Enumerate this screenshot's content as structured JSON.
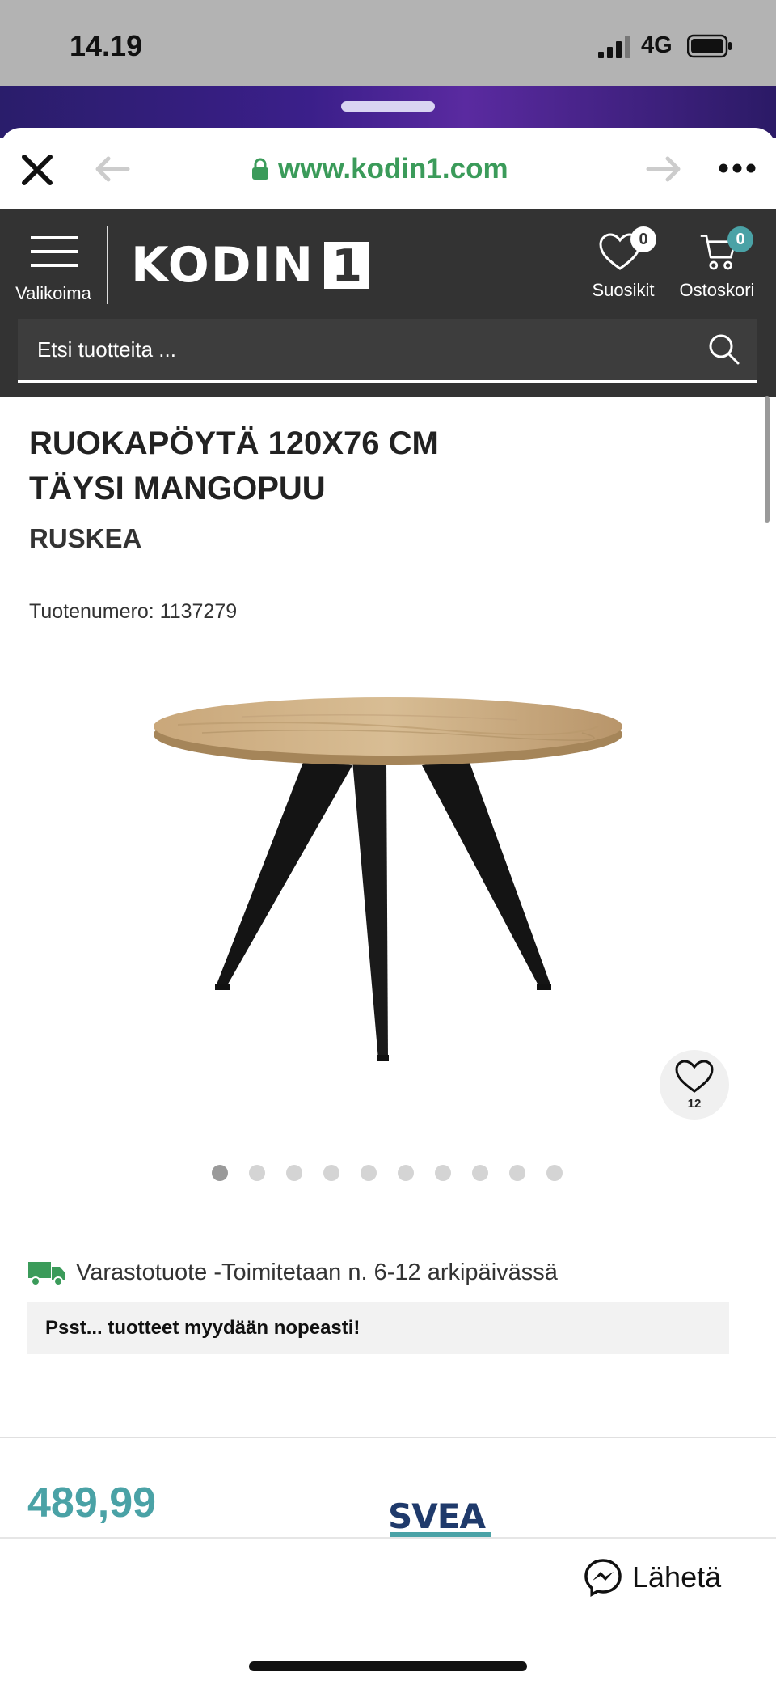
{
  "status_bar": {
    "time": "14.19",
    "network": "4G"
  },
  "browser": {
    "url": "www.kodin1.com"
  },
  "header": {
    "menu_label": "Valikoima",
    "logo_text": "KODIN",
    "logo_number": "1",
    "favorites_label": "Suosikit",
    "favorites_count": "0",
    "cart_label": "Ostoskori",
    "cart_count": "0",
    "search_placeholder": "Etsi tuotteita ..."
  },
  "product": {
    "title_line1": "RUOKAPÖYTÄ 120X76 CM",
    "title_line2": "TÄYSI MANGOPUU",
    "color": "RUSKEA",
    "sku_text": "Tuotenumero: 1137279",
    "wishlist_count": "12",
    "gallery_images": 10,
    "gallery_active_index": 0,
    "stock_text": "Varastotuote -Toimitetaan n. 6-12 arkipäivässä",
    "urgency_text": "Psst... tuotteet myydään nopeasti!",
    "price": "489,99",
    "financing_logo": "SVEA"
  },
  "bottom": {
    "send_label": "Lähetä"
  },
  "colors": {
    "header_bg": "#333333",
    "accent_green": "#3b9b5a",
    "price_teal": "#4aa2a6",
    "svea_navy": "#1f3a6b"
  }
}
